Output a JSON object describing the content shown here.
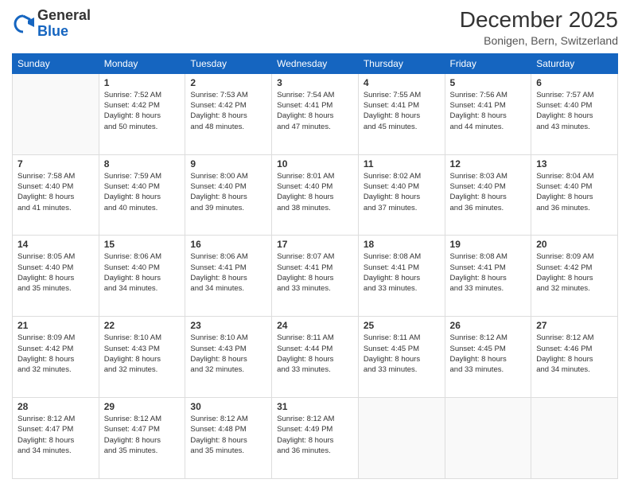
{
  "header": {
    "logo": {
      "general": "General",
      "blue": "Blue"
    },
    "title": "December 2025",
    "location": "Bonigen, Bern, Switzerland"
  },
  "days_of_week": [
    "Sunday",
    "Monday",
    "Tuesday",
    "Wednesday",
    "Thursday",
    "Friday",
    "Saturday"
  ],
  "weeks": [
    [
      {
        "day": "",
        "info": ""
      },
      {
        "day": "1",
        "info": "Sunrise: 7:52 AM\nSunset: 4:42 PM\nDaylight: 8 hours\nand 50 minutes."
      },
      {
        "day": "2",
        "info": "Sunrise: 7:53 AM\nSunset: 4:42 PM\nDaylight: 8 hours\nand 48 minutes."
      },
      {
        "day": "3",
        "info": "Sunrise: 7:54 AM\nSunset: 4:41 PM\nDaylight: 8 hours\nand 47 minutes."
      },
      {
        "day": "4",
        "info": "Sunrise: 7:55 AM\nSunset: 4:41 PM\nDaylight: 8 hours\nand 45 minutes."
      },
      {
        "day": "5",
        "info": "Sunrise: 7:56 AM\nSunset: 4:41 PM\nDaylight: 8 hours\nand 44 minutes."
      },
      {
        "day": "6",
        "info": "Sunrise: 7:57 AM\nSunset: 4:40 PM\nDaylight: 8 hours\nand 43 minutes."
      }
    ],
    [
      {
        "day": "7",
        "info": "Sunrise: 7:58 AM\nSunset: 4:40 PM\nDaylight: 8 hours\nand 41 minutes."
      },
      {
        "day": "8",
        "info": "Sunrise: 7:59 AM\nSunset: 4:40 PM\nDaylight: 8 hours\nand 40 minutes."
      },
      {
        "day": "9",
        "info": "Sunrise: 8:00 AM\nSunset: 4:40 PM\nDaylight: 8 hours\nand 39 minutes."
      },
      {
        "day": "10",
        "info": "Sunrise: 8:01 AM\nSunset: 4:40 PM\nDaylight: 8 hours\nand 38 minutes."
      },
      {
        "day": "11",
        "info": "Sunrise: 8:02 AM\nSunset: 4:40 PM\nDaylight: 8 hours\nand 37 minutes."
      },
      {
        "day": "12",
        "info": "Sunrise: 8:03 AM\nSunset: 4:40 PM\nDaylight: 8 hours\nand 36 minutes."
      },
      {
        "day": "13",
        "info": "Sunrise: 8:04 AM\nSunset: 4:40 PM\nDaylight: 8 hours\nand 36 minutes."
      }
    ],
    [
      {
        "day": "14",
        "info": "Sunrise: 8:05 AM\nSunset: 4:40 PM\nDaylight: 8 hours\nand 35 minutes."
      },
      {
        "day": "15",
        "info": "Sunrise: 8:06 AM\nSunset: 4:40 PM\nDaylight: 8 hours\nand 34 minutes."
      },
      {
        "day": "16",
        "info": "Sunrise: 8:06 AM\nSunset: 4:41 PM\nDaylight: 8 hours\nand 34 minutes."
      },
      {
        "day": "17",
        "info": "Sunrise: 8:07 AM\nSunset: 4:41 PM\nDaylight: 8 hours\nand 33 minutes."
      },
      {
        "day": "18",
        "info": "Sunrise: 8:08 AM\nSunset: 4:41 PM\nDaylight: 8 hours\nand 33 minutes."
      },
      {
        "day": "19",
        "info": "Sunrise: 8:08 AM\nSunset: 4:41 PM\nDaylight: 8 hours\nand 33 minutes."
      },
      {
        "day": "20",
        "info": "Sunrise: 8:09 AM\nSunset: 4:42 PM\nDaylight: 8 hours\nand 32 minutes."
      }
    ],
    [
      {
        "day": "21",
        "info": "Sunrise: 8:09 AM\nSunset: 4:42 PM\nDaylight: 8 hours\nand 32 minutes."
      },
      {
        "day": "22",
        "info": "Sunrise: 8:10 AM\nSunset: 4:43 PM\nDaylight: 8 hours\nand 32 minutes."
      },
      {
        "day": "23",
        "info": "Sunrise: 8:10 AM\nSunset: 4:43 PM\nDaylight: 8 hours\nand 32 minutes."
      },
      {
        "day": "24",
        "info": "Sunrise: 8:11 AM\nSunset: 4:44 PM\nDaylight: 8 hours\nand 33 minutes."
      },
      {
        "day": "25",
        "info": "Sunrise: 8:11 AM\nSunset: 4:45 PM\nDaylight: 8 hours\nand 33 minutes."
      },
      {
        "day": "26",
        "info": "Sunrise: 8:12 AM\nSunset: 4:45 PM\nDaylight: 8 hours\nand 33 minutes."
      },
      {
        "day": "27",
        "info": "Sunrise: 8:12 AM\nSunset: 4:46 PM\nDaylight: 8 hours\nand 34 minutes."
      }
    ],
    [
      {
        "day": "28",
        "info": "Sunrise: 8:12 AM\nSunset: 4:47 PM\nDaylight: 8 hours\nand 34 minutes."
      },
      {
        "day": "29",
        "info": "Sunrise: 8:12 AM\nSunset: 4:47 PM\nDaylight: 8 hours\nand 35 minutes."
      },
      {
        "day": "30",
        "info": "Sunrise: 8:12 AM\nSunset: 4:48 PM\nDaylight: 8 hours\nand 35 minutes."
      },
      {
        "day": "31",
        "info": "Sunrise: 8:12 AM\nSunset: 4:49 PM\nDaylight: 8 hours\nand 36 minutes."
      },
      {
        "day": "",
        "info": ""
      },
      {
        "day": "",
        "info": ""
      },
      {
        "day": "",
        "info": ""
      }
    ]
  ]
}
